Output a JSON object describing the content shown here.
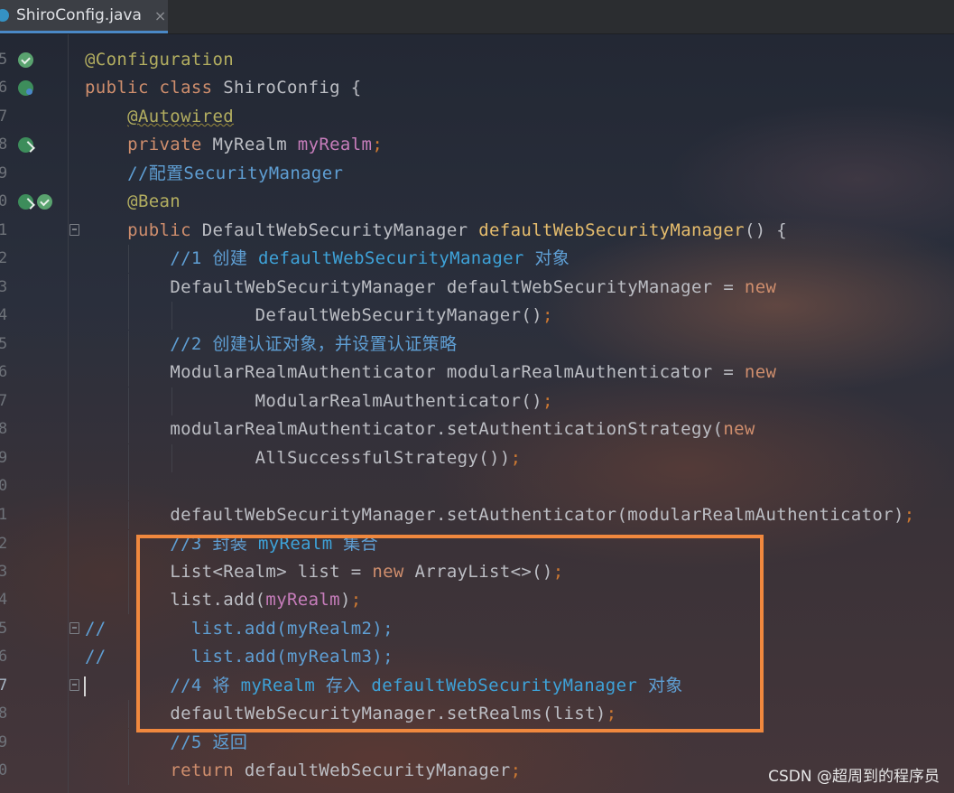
{
  "tab": {
    "label": "ShiroConfig.java",
    "close": "×"
  },
  "lines": [
    {
      "num": "5",
      "text": "@Configuration"
    },
    {
      "num": "6",
      "kw": "public class ",
      "rest": "ShiroConfig {"
    },
    {
      "num": "7",
      "text": "@Autowired"
    },
    {
      "num": "8",
      "kw": "private ",
      "type": "MyRealm ",
      "field": "myRealm",
      "semi": ";"
    },
    {
      "num": "9",
      "text": "//配置SecurityManager"
    },
    {
      "num": "0",
      "text": "@Bean"
    },
    {
      "num": "1",
      "kw": "public ",
      "type": "DefaultWebSecurityManager ",
      "method": "defaultWebSecurityManager",
      "rest": "() {"
    },
    {
      "num": "2",
      "c1": "//1 创建 ",
      "c2": "defaultWebSecurityManager",
      "c3": " 对象"
    },
    {
      "num": "3",
      "pre": "DefaultWebSecurityManager defaultWebSecurityManager = ",
      "kw": "new"
    },
    {
      "num": "4",
      "pre": "DefaultWebSecurityManager()",
      "semi": ";"
    },
    {
      "num": "5",
      "text": "//2 创建认证对象，并设置认证策略"
    },
    {
      "num": "6",
      "pre": "ModularRealmAuthenticator modularRealmAuthenticator = ",
      "kw": "new"
    },
    {
      "num": "7",
      "pre": "ModularRealmAuthenticator()",
      "semi": ";"
    },
    {
      "num": "8",
      "pre": "modularRealmAuthenticator.setAuthenticationStrategy(",
      "kw": "new"
    },
    {
      "num": "9",
      "pre": "AllSuccessfulStrategy())",
      "semi": ";"
    },
    {
      "num": "0",
      "text": ""
    },
    {
      "num": "1",
      "pre": "defaultWebSecurityManager.setAuthenticator(modularRealmAuthenticator)",
      "semi": ";"
    },
    {
      "num": "2",
      "c1": "//3 封装 ",
      "c2": "myRealm",
      "c3": " 集合"
    },
    {
      "num": "3",
      "pre": "List<Realm> list = ",
      "kw": "new ",
      "post": "ArrayList<>()",
      "semi": ";"
    },
    {
      "num": "4",
      "pre": "list.add(",
      "field": "myRealm",
      "post": ")",
      "semi": ";"
    },
    {
      "num": "5",
      "c1": "//",
      "c2": "list.add(myRealm2);"
    },
    {
      "num": "6",
      "c1": "//",
      "c2": "list.add(myRealm3);"
    },
    {
      "num": "7",
      "c1": "//4 将 ",
      "c2": "myRealm",
      "c3": " 存入 ",
      "c4": "defaultWebSecurityManager",
      "c5": " 对象"
    },
    {
      "num": "8",
      "pre": "defaultWebSecurityManager.setRealms(list)",
      "semi": ";"
    },
    {
      "num": "9",
      "text": "//5 返回"
    },
    {
      "num": "0",
      "kw": "return ",
      "pre": "defaultWebSecurityManager",
      "semi": ";"
    }
  ],
  "watermark": "CSDN @超周到的程序员",
  "colors": {
    "keyword": "#cf8e6d",
    "annotation": "#b3ae60",
    "comment": "#5f9fd4",
    "field": "#c77dbb",
    "method_decl": "#e6bd6d",
    "highlight_box": "#f0883e"
  }
}
